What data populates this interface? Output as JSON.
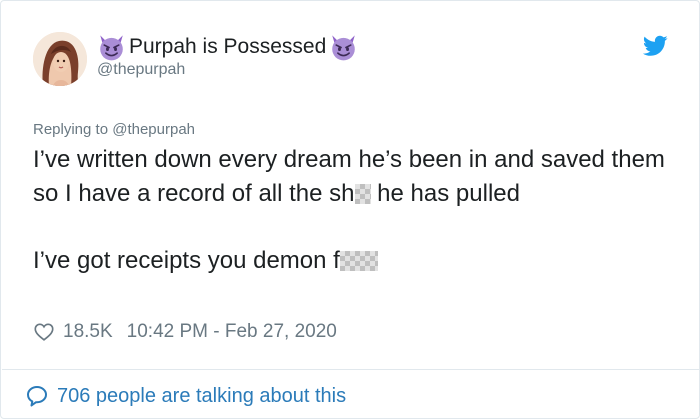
{
  "author": {
    "display_name": "Purpah is Possessed",
    "handle": "@thepurpah",
    "name_emoji": "smiling-imp-emoji"
  },
  "reply": {
    "prefix": "Replying to",
    "mention": "@thepurpah"
  },
  "tweet": {
    "para1_text": "I’ve written down every dream he’s been in and saved them so I have a record of all the sh",
    "para1_end": " he has pulled",
    "para2_text": "I’ve got receipts you demon f"
  },
  "meta": {
    "likes": "18.5K",
    "timestamp": "10:42 PM - Feb 27, 2020"
  },
  "footer": {
    "talking_text": "706 people are talking about this"
  },
  "colors": {
    "text": "#1c2022",
    "muted": "#697882",
    "link": "#2b7bb9",
    "twitter_blue": "#1da1f2",
    "emoji_purple": "#8f62c9"
  },
  "icons": {
    "brand": "twitter-bird-icon",
    "like": "heart-outline-icon",
    "talking": "speech-bubble-icon"
  }
}
